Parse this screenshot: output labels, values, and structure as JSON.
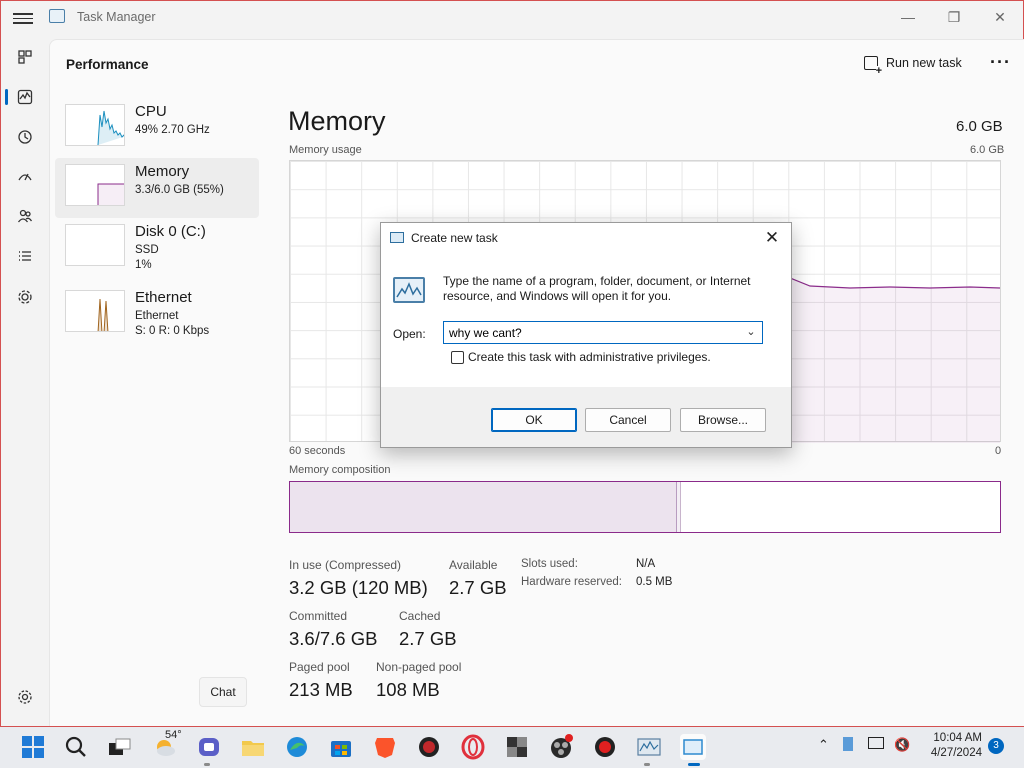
{
  "window": {
    "title": "Task Manager"
  },
  "header": {
    "page_title": "Performance",
    "run_new_task": "Run new task"
  },
  "perf_list": [
    {
      "name": "CPU",
      "line1": "49%  2.70 GHz",
      "line2": ""
    },
    {
      "name": "Memory",
      "line1": "3.3/6.0 GB (55%)",
      "line2": ""
    },
    {
      "name": "Disk 0 (C:)",
      "line1": "SSD",
      "line2": "1%"
    },
    {
      "name": "Ethernet",
      "line1": "Ethernet",
      "line2": "S: 0  R: 0 Kbps"
    }
  ],
  "main": {
    "title": "Memory",
    "total": "6.0 GB",
    "usage_label": "Memory usage",
    "usage_max": "6.0 GB",
    "x_left": "60 seconds",
    "x_right": "0",
    "composition_label": "Memory composition",
    "composition_used_fraction": 0.545
  },
  "stats": {
    "in_use_label": "In use (Compressed)",
    "in_use_value": "3.2 GB (120 MB)",
    "available_label": "Available",
    "available_value": "2.7 GB",
    "slots_label": "Slots used:",
    "slots_value": "N/A",
    "hw_reserved_label": "Hardware reserved:",
    "hw_reserved_value": "0.5 MB",
    "committed_label": "Committed",
    "committed_value": "3.6/7.6 GB",
    "cached_label": "Cached",
    "cached_value": "2.7 GB",
    "paged_label": "Paged pool",
    "paged_value": "213 MB",
    "nonpaged_label": "Non-paged pool",
    "nonpaged_value": "108 MB"
  },
  "tooltip": {
    "chat": "Chat"
  },
  "dialog": {
    "title": "Create new task",
    "description": "Type the name of a program, folder, document, or Internet resource, and Windows will open it for you.",
    "open_label": "Open:",
    "open_value": "why we cant?",
    "admin_checkbox": "Create this task with administrative privileges.",
    "ok": "OK",
    "cancel": "Cancel",
    "browse": "Browse..."
  },
  "taskbar": {
    "weather": "54°",
    "time": "10:04 AM",
    "date": "4/27/2024",
    "notifications": "3"
  },
  "colors": {
    "accent": "#0067c0",
    "memory": "#8b2c8b",
    "cpu": "#1b8fbf",
    "ethernet": "#a0641e"
  }
}
